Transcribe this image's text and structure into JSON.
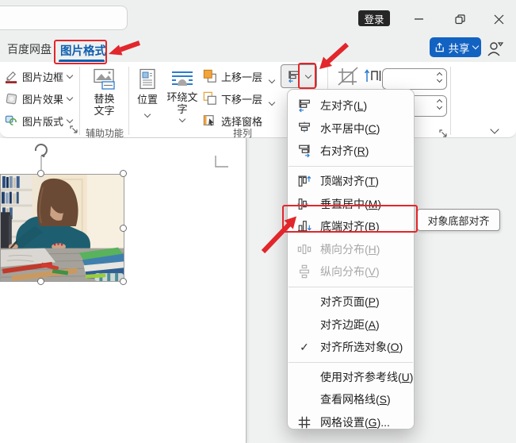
{
  "topbar": {
    "login": "登录",
    "share": "共享"
  },
  "tabs": {
    "baidu_netdisk": "百度网盘",
    "picture_format": "图片格式"
  },
  "ribbon": {
    "picture_border": "图片边框",
    "picture_effects": "图片效果",
    "picture_layout": "图片版式",
    "alt_text": "替换文字",
    "accessibility_group_label": "辅助功能",
    "position": "位置",
    "wrap_text": "环绕文字",
    "bring_forward": "上移一层",
    "send_backward": "下移一层",
    "selection_pane": "选择窗格",
    "arrange_group_label": "排列"
  },
  "align_menu": {
    "items": [
      {
        "label": "左对齐(L)",
        "icon": "align-left-icon",
        "state": "normal"
      },
      {
        "label": "水平居中(C)",
        "icon": "align-center-icon",
        "state": "normal"
      },
      {
        "label": "右对齐(R)",
        "icon": "align-right-icon",
        "state": "normal"
      },
      {
        "label": "顶端对齐(T)",
        "icon": "align-top-icon",
        "state": "normal"
      },
      {
        "label": "垂直居中(M)",
        "icon": "align-middle-icon",
        "state": "normal"
      },
      {
        "label": "底端对齐(B)",
        "icon": "align-bottom-icon",
        "state": "highlighted"
      },
      {
        "label": "横向分布(H)",
        "icon": "distribute-horizontal-icon",
        "state": "disabled"
      },
      {
        "label": "纵向分布(V)",
        "icon": "distribute-vertical-icon",
        "state": "disabled"
      },
      {
        "label": "对齐页面(P)",
        "icon": "",
        "state": "normal"
      },
      {
        "label": "对齐边距(A)",
        "icon": "",
        "state": "normal"
      },
      {
        "label": "对齐所选对象(O)",
        "icon": "check-icon",
        "state": "checked"
      },
      {
        "label": "使用对齐参考线(U)",
        "icon": "",
        "state": "normal"
      },
      {
        "label": "查看网格线(S)",
        "icon": "",
        "state": "normal"
      },
      {
        "label": "网格设置(G)...",
        "icon": "grid-icon",
        "state": "normal"
      }
    ]
  },
  "tooltip": "对象底部对齐",
  "glyphs": {
    "check": "✓"
  },
  "colors": {
    "accent_blue": "#0f5fb0",
    "share_blue": "#1262c2",
    "annotation_red": "#e2262b",
    "icon_orange": "#f2a33c",
    "icon_blue": "#2b7cd3"
  }
}
